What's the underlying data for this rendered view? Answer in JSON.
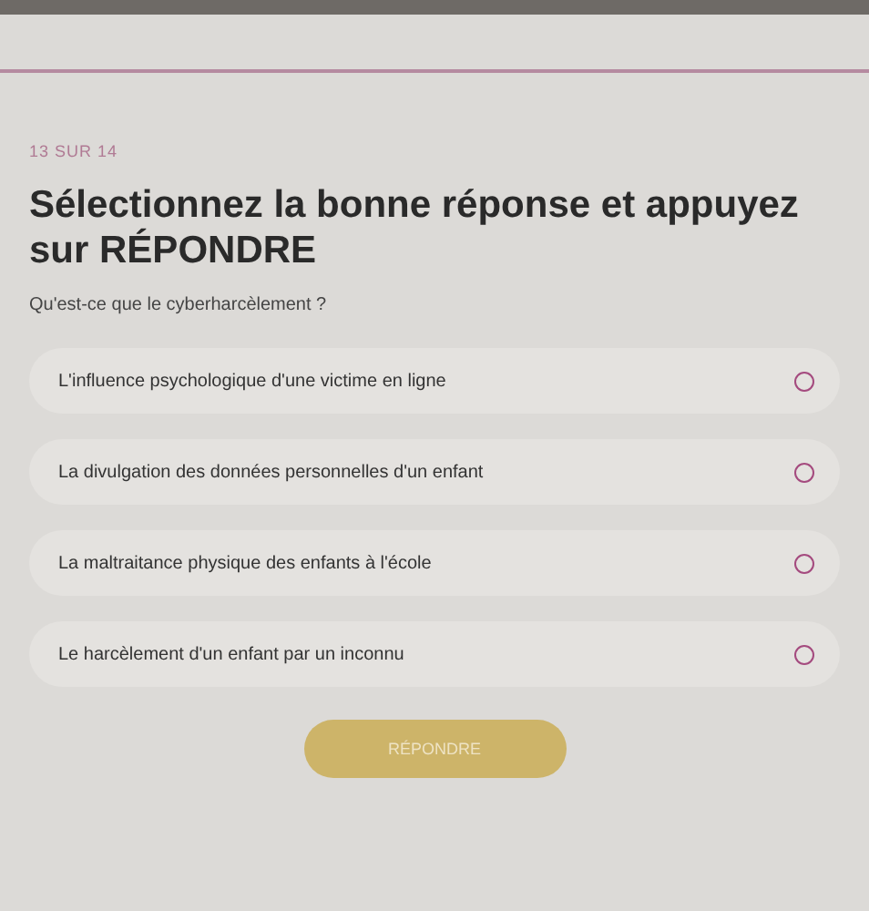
{
  "progress": "13 SUR 14",
  "title": "Sélectionnez la bonne réponse et appuyez sur RÉPONDRE",
  "question": "Qu'est-ce que le cyberharcèlement ?",
  "options": [
    {
      "label": "L'influence psychologique d'une victime en ligne",
      "selected": false
    },
    {
      "label": "La divulgation des données personnelles d'un enfant",
      "selected": false
    },
    {
      "label": "La maltraitance physique des enfants à l'école",
      "selected": false
    },
    {
      "label": "Le harcèlement d'un enfant par un inconnu",
      "selected": false
    }
  ],
  "submit": {
    "label": "RÉPONDRE",
    "disabled": true
  }
}
